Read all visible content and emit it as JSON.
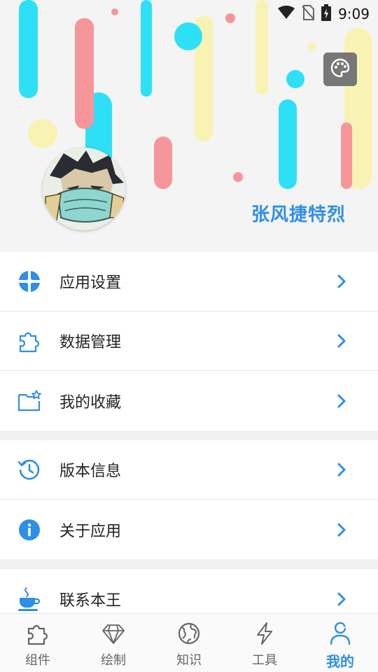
{
  "status_bar": {
    "time": "9:09"
  },
  "profile": {
    "username": "张风捷特烈"
  },
  "menu_group_1": [
    {
      "label": "应用设置",
      "icon": "settings-shape-icon"
    },
    {
      "label": "数据管理",
      "icon": "puzzle-icon"
    },
    {
      "label": "我的收藏",
      "icon": "folder-star-icon"
    }
  ],
  "menu_group_2": [
    {
      "label": "版本信息",
      "icon": "history-icon"
    },
    {
      "label": "关于应用",
      "icon": "info-icon"
    }
  ],
  "menu_group_3": [
    {
      "label": "联系本王",
      "icon": "coffee-cup-icon"
    }
  ],
  "tabs": [
    {
      "label": "组件",
      "icon": "puzzle-icon",
      "active": false
    },
    {
      "label": "绘制",
      "icon": "diamond-icon",
      "active": false
    },
    {
      "label": "知识",
      "icon": "globe-icon",
      "active": false
    },
    {
      "label": "工具",
      "icon": "lightning-icon",
      "active": false
    },
    {
      "label": "我的",
      "icon": "user-icon",
      "active": true
    }
  ],
  "colors": {
    "accent": "#2e8fe6",
    "stripe_cyan": "#2de0f6",
    "stripe_pink": "#f7969a",
    "stripe_yellow": "#f8f3b3"
  }
}
